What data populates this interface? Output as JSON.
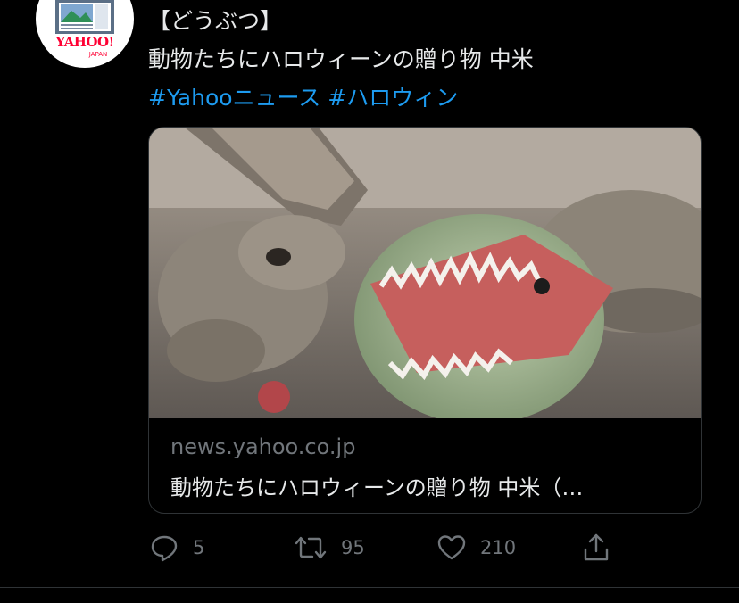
{
  "avatar": {
    "brand_text": "YAHOO!",
    "brand_sub": "JAPAN"
  },
  "tweet": {
    "line1": "【どうぶつ】",
    "line2": "動物たちにハロウィーンの贈り物 中米",
    "hashtags": [
      "#Yahooニュース",
      "#ハロウィン"
    ]
  },
  "card": {
    "domain": "news.yahoo.co.jp",
    "title": "動物たちにハロウィーンの贈り物 中米（…"
  },
  "actions": {
    "reply_count": "5",
    "retweet_count": "95",
    "like_count": "210"
  },
  "colors": {
    "background": "#000000",
    "text": "#e7e9ea",
    "secondary": "#71767b",
    "link": "#1d9bf0",
    "border": "#2f3336",
    "brand": "#ff0033"
  }
}
